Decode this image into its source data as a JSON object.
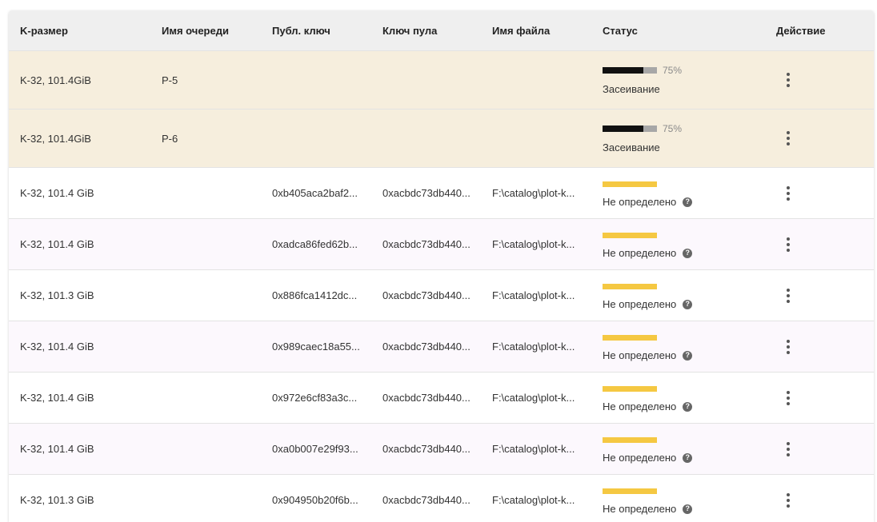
{
  "columns": {
    "size": "K-размер",
    "queue": "Имя очереди",
    "pub": "Публ. ключ",
    "pool": "Ключ пула",
    "file": "Имя файла",
    "status": "Статус",
    "action": "Действие"
  },
  "queued_rows": [
    {
      "size": "K-32, 101.4GiB",
      "queue": "P-5",
      "progress": 75,
      "progress_label": "75%",
      "status": "Засеивание"
    },
    {
      "size": "K-32, 101.4GiB",
      "queue": "P-6",
      "progress": 75,
      "progress_label": "75%",
      "status": "Засеивание"
    }
  ],
  "plot_rows": [
    {
      "size": "K-32, 101.4 GiB",
      "pub": "0xb405aca2baf2...",
      "pool": "0xacbdc73db440...",
      "file": "F:\\catalog\\plot-k...",
      "status": "Не определено"
    },
    {
      "size": "K-32, 101.4 GiB",
      "pub": "0xadca86fed62b...",
      "pool": "0xacbdc73db440...",
      "file": "F:\\catalog\\plot-k...",
      "status": "Не определено"
    },
    {
      "size": "K-32, 101.3 GiB",
      "pub": "0x886fca1412dc...",
      "pool": "0xacbdc73db440...",
      "file": "F:\\catalog\\plot-k...",
      "status": "Не определено"
    },
    {
      "size": "K-32, 101.4 GiB",
      "pub": "0x989caec18a55...",
      "pool": "0xacbdc73db440...",
      "file": "F:\\catalog\\plot-k...",
      "status": "Не определено"
    },
    {
      "size": "K-32, 101.4 GiB",
      "pub": "0x972e6cf83a3c...",
      "pool": "0xacbdc73db440...",
      "file": "F:\\catalog\\plot-k...",
      "status": "Не определено"
    },
    {
      "size": "K-32, 101.4 GiB",
      "pub": "0xa0b007e29f93...",
      "pool": "0xacbdc73db440...",
      "file": "F:\\catalog\\plot-k...",
      "status": "Не определено"
    },
    {
      "size": "K-32, 101.3 GiB",
      "pub": "0x904950b20f6b...",
      "pool": "0xacbdc73db440...",
      "file": "F:\\catalog\\plot-k...",
      "status": "Не определено"
    }
  ],
  "icons": {
    "help": "?",
    "more": "more-vert-icon",
    "help_name": "help-circle-icon"
  },
  "colors": {
    "queued_bg": "#f6eedd",
    "progress_fill": "#111111",
    "progress_track": "#a7a7a7",
    "undetermined_bar": "#f5c842"
  }
}
